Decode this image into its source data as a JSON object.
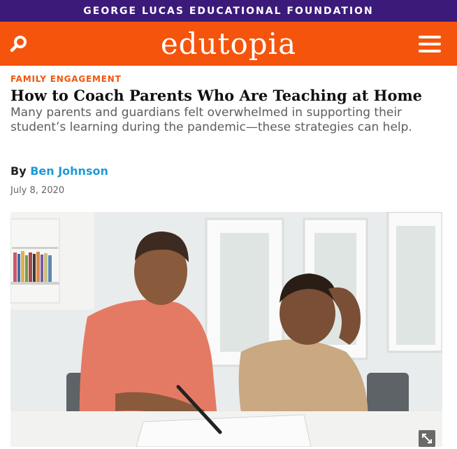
{
  "foundation_bar": {
    "text": "GEORGE LUCAS EDUCATIONAL FOUNDATION"
  },
  "header": {
    "logo": "edutopia",
    "search_icon": "search-icon",
    "menu_icon": "hamburger-menu-icon"
  },
  "article": {
    "category": "FAMILY ENGAGEMENT",
    "title": "How to Coach Parents Who Are Teaching at Home",
    "subtitle": "Many parents and guardians felt overwhelmed in supporting their student’s learning during the pandemic—these strategies can help.",
    "byline_prefix": "By",
    "author": "Ben Johnson",
    "date": "July 8, 2020"
  },
  "hero_image": {
    "expand_icon": "expand-icon"
  },
  "colors": {
    "purple": "#3b1a7a",
    "orange": "#f5540c",
    "link_blue": "#1c9ad6"
  }
}
